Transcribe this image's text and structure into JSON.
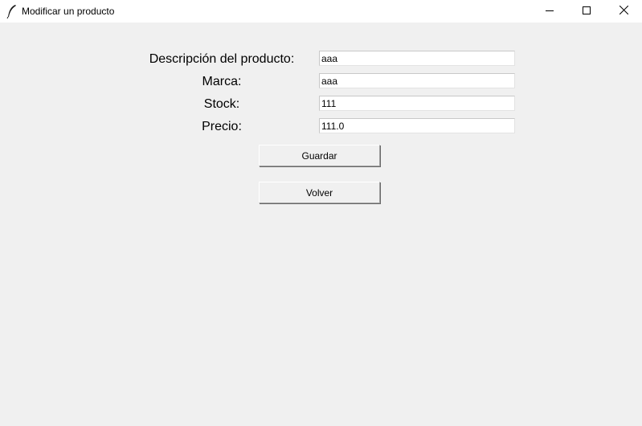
{
  "window": {
    "title": "Modificar un producto",
    "icon": "feather-icon",
    "controls": [
      "minimize-icon",
      "maximize-icon",
      "close-icon"
    ]
  },
  "form": {
    "descripcion_label": "Descripción del producto:",
    "descripcion_value": "aaa",
    "marca_label": "Marca:",
    "marca_value": "aaa",
    "stock_label": "Stock:",
    "stock_value": "111",
    "precio_label": "Precio:",
    "precio_value": "111.0"
  },
  "buttons": {
    "guardar": "Guardar",
    "volver": "Volver"
  },
  "colors": {
    "window_background": "#f0f0f0",
    "titlebar_background": "#ffffff"
  }
}
